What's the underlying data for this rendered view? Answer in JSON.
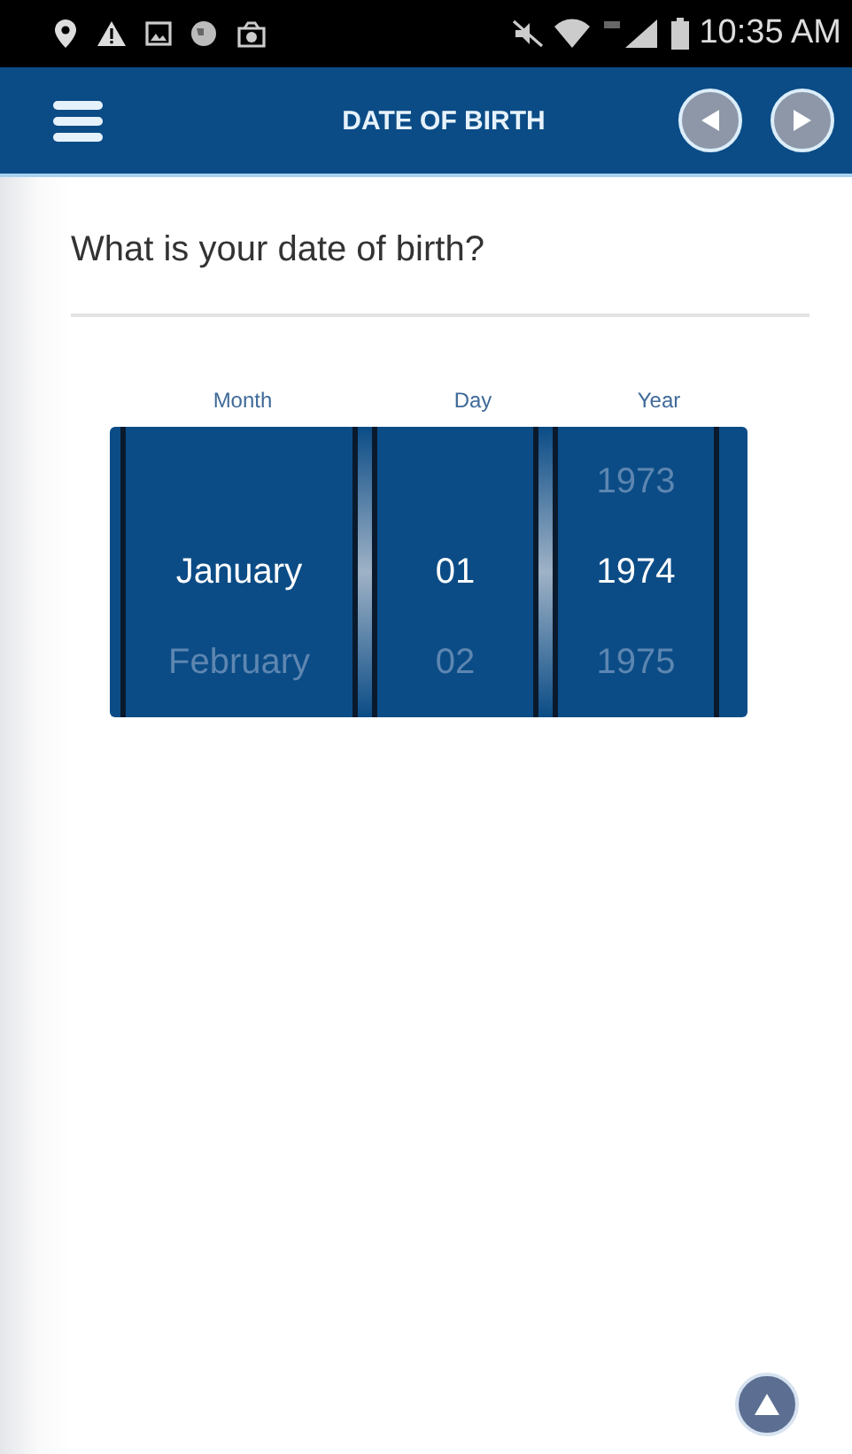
{
  "status_bar": {
    "time": "10:35 AM"
  },
  "header": {
    "title": "DATE OF BIRTH"
  },
  "question": "What is your date of birth?",
  "picker": {
    "columns": [
      {
        "label": "Month",
        "items": [
          {
            "text": "January",
            "selected": true
          },
          {
            "text": "February",
            "selected": false
          }
        ]
      },
      {
        "label": "Day",
        "items": [
          {
            "text": "01",
            "selected": true
          },
          {
            "text": "02",
            "selected": false
          }
        ]
      },
      {
        "label": "Year",
        "items": [
          {
            "text": "1973",
            "selected": false
          },
          {
            "text": "1974",
            "selected": true
          },
          {
            "text": "1975",
            "selected": false
          }
        ]
      }
    ]
  }
}
